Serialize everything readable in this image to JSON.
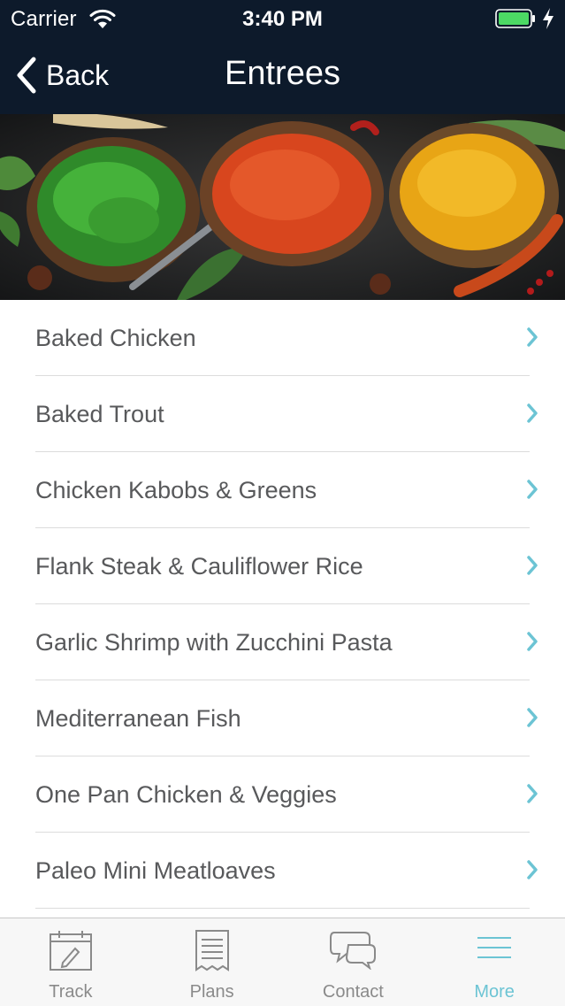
{
  "status_bar": {
    "carrier": "Carrier",
    "time": "3:40 PM"
  },
  "nav": {
    "back_label": "Back",
    "title": "Entrees"
  },
  "entrees": [
    {
      "label": "Baked Chicken"
    },
    {
      "label": "Baked Trout"
    },
    {
      "label": "Chicken Kabobs & Greens"
    },
    {
      "label": "Flank Steak & Cauliflower Rice"
    },
    {
      "label": "Garlic Shrimp with Zucchini Pasta"
    },
    {
      "label": "Mediterranean Fish"
    },
    {
      "label": "One Pan Chicken & Veggies"
    },
    {
      "label": "Paleo Mini Meatloaves"
    }
  ],
  "tabs": [
    {
      "label": "Track",
      "icon": "calendar-edit-icon",
      "active": false
    },
    {
      "label": "Plans",
      "icon": "document-list-icon",
      "active": false
    },
    {
      "label": "Contact",
      "icon": "chat-bubbles-icon",
      "active": false
    },
    {
      "label": "More",
      "icon": "menu-lines-icon",
      "active": true
    }
  ],
  "colors": {
    "header_bg": "#0d1a2b",
    "accent": "#6cc4d4",
    "row_text": "#58595b",
    "battery_green": "#4cd964"
  }
}
